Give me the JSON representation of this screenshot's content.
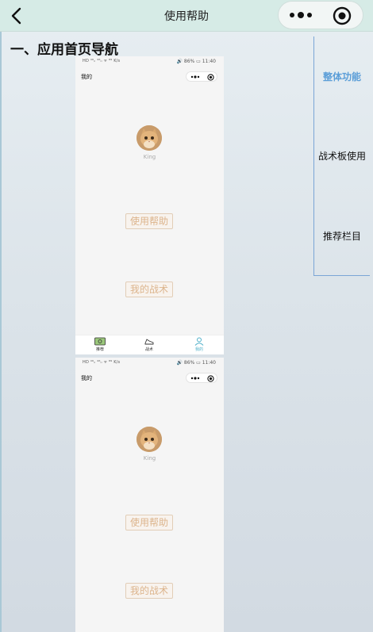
{
  "nav": {
    "title": "使用帮助",
    "back_icon": "chevron-left-icon",
    "more_icon": "more-dots-icon",
    "close_icon": "target-circle-icon"
  },
  "section": {
    "heading": "一、应用首页导航"
  },
  "side_nav": {
    "items": [
      {
        "label": "整体功能",
        "active": true
      },
      {
        "label": "战术板使用",
        "active": false
      },
      {
        "label": "推荐栏目",
        "active": false
      }
    ],
    "active_color": "#5b9ed8"
  },
  "screenshots": [
    {
      "status_left": "HD ⁴⁶ᵢₗ ⁴⁶ᵢₗ ᯤ ⁸⁹ K/s",
      "status_right": "🔊 86% ▭ 11:40",
      "page_title": "我的",
      "avatar_name": "King",
      "help_link": "使用帮助",
      "tactics_link": "我的战术",
      "tabs": [
        {
          "label": "推荐",
          "icon": "recommend-icon",
          "active": false
        },
        {
          "label": "战术",
          "icon": "tactics-shoe-icon",
          "active": false
        },
        {
          "label": "我的",
          "icon": "user-icon",
          "active": true
        }
      ]
    },
    {
      "status_left": "HD ⁴⁶ᵢₗ ⁴⁶ᵢₗ ᯤ ⁸⁹ K/s",
      "status_right": "🔊 86% ▭ 11:40",
      "page_title": "我的",
      "avatar_name": "King",
      "help_link": "使用帮助",
      "tactics_link": "我的战术"
    }
  ]
}
